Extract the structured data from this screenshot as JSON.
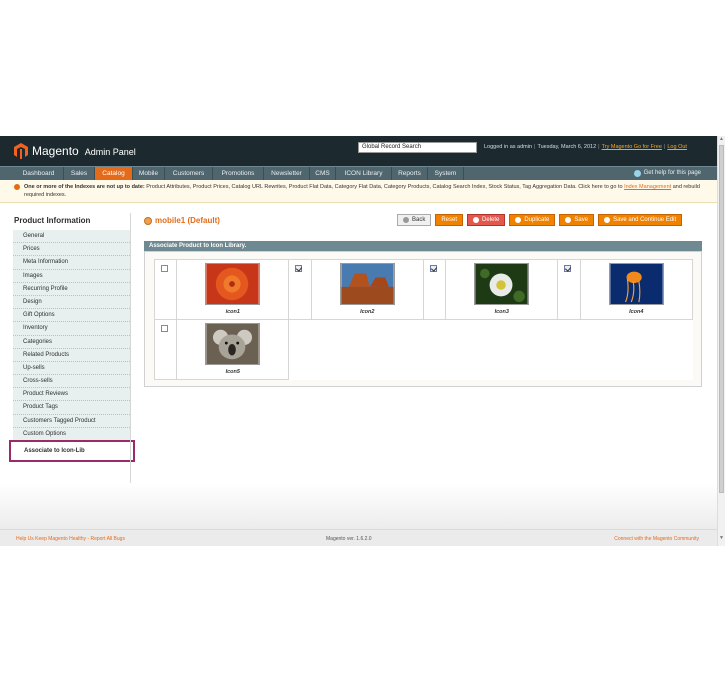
{
  "header": {
    "logo_text": "Magento",
    "logo_sub": "Admin Panel",
    "search_value": "Global Record Search",
    "logged_in": "Logged in as admin",
    "date": "Tuesday, March 6, 2012",
    "try_link": "Try Magento Go for Free",
    "logout": "Log Out"
  },
  "nav": {
    "items": [
      "Dashboard",
      "Sales",
      "Catalog",
      "Mobile",
      "Customers",
      "Promotions",
      "Newsletter",
      "CMS",
      "ICON Library",
      "Reports",
      "System"
    ],
    "active": "Catalog",
    "help": "Get help for this page"
  },
  "notice": {
    "bold": "One or more of the Indexes are not up to date:",
    "text": " Product Attributes, Product Prices, Catalog URL Rewrites, Product Flat Data, Category Flat Data, Category Products, Catalog Search Index, Stock Status, Tag Aggregation Data. Click here to go to ",
    "link": "Index Management",
    "tail": " and rebuild required indexes."
  },
  "sidebar": {
    "title": "Product Information",
    "items": [
      "General",
      "Prices",
      "Meta Information",
      "Images",
      "Recurring Profile",
      "Design",
      "Gift Options",
      "Inventory",
      "Categories",
      "Related Products",
      "Up-sells",
      "Cross-sells",
      "Product Reviews",
      "Product Tags",
      "Customers Tagged Product",
      "Custom Options",
      "Associate to Icon-Lib"
    ],
    "selected": "Associate to Icon-Lib"
  },
  "page": {
    "title": "mobile1 (Default)",
    "buttons": {
      "back": "Back",
      "reset": "Reset",
      "delete": "Delete",
      "duplicate": "Duplicate",
      "save": "Save",
      "save_continue": "Save and Continue Edit"
    },
    "section_title": "Associate Product to Icon Library."
  },
  "icons": [
    {
      "caption": "icon1",
      "checked": false
    },
    {
      "caption": "Icon2",
      "checked": true
    },
    {
      "caption": "Icon3",
      "checked": true
    },
    {
      "caption": "Icon4",
      "checked": true
    },
    {
      "caption": "Icon5",
      "checked": false
    }
  ],
  "footer": {
    "left": "Help Us Keep Magento Healthy - Report All Bugs",
    "center": "Magento ver. 1.6.2.0",
    "right": "Connect with the Magento Community"
  },
  "colors": {
    "accent": "#e46b1a",
    "header": "#1c2a30",
    "nav": "#50666f"
  }
}
